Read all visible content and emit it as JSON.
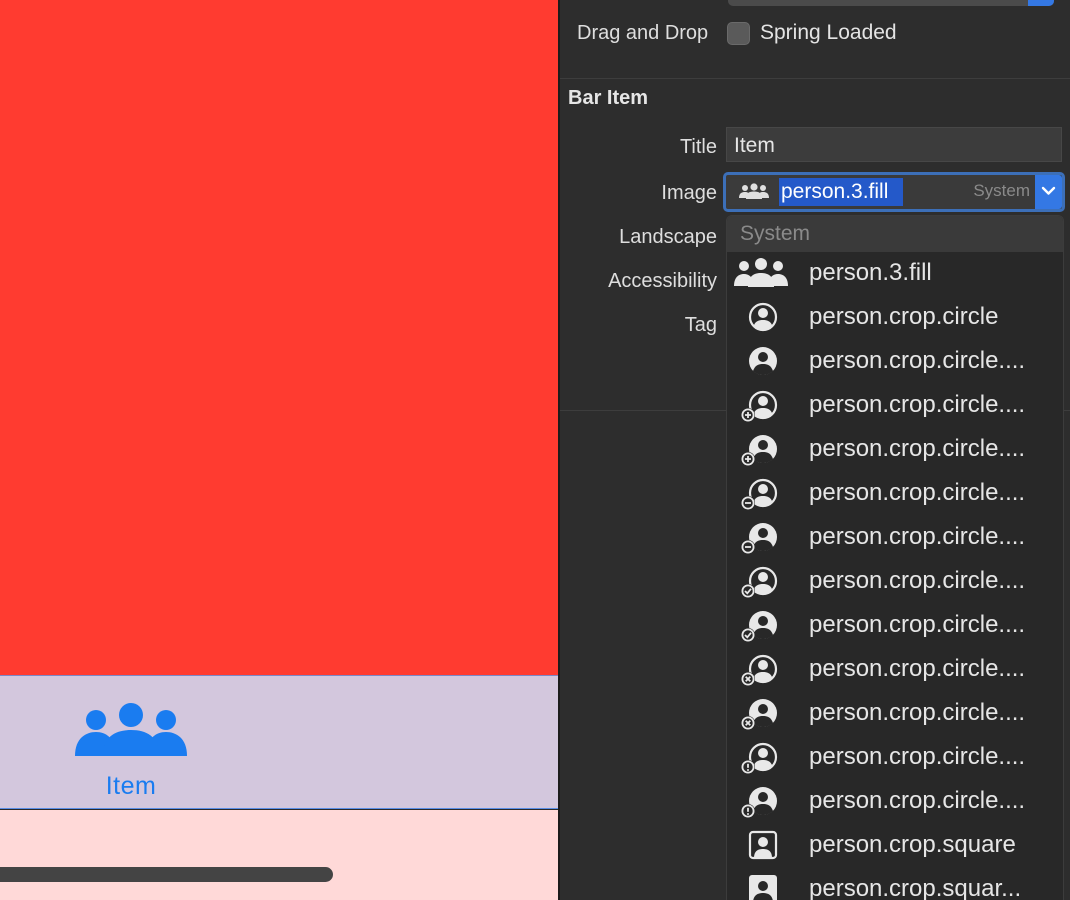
{
  "canvas": {
    "tab_item_label": "Item"
  },
  "inspector": {
    "drag_drop_label": "Drag and Drop",
    "spring_loaded_label": "Spring Loaded",
    "section_title": "Bar Item",
    "title_label": "Title",
    "title_value": "Item",
    "image_label": "Image",
    "image_value": "person.3.fill",
    "image_badge": "System",
    "landscape_label": "Landscape",
    "accessibility_label": "Accessibility",
    "tag_label": "Tag"
  },
  "popup": {
    "header": "System",
    "options": [
      {
        "label": "person.3.fill",
        "icon": "person-3-fill-icon"
      },
      {
        "label": "person.crop.circle",
        "icon": "person-crop-circle-icon"
      },
      {
        "label": "person.crop.circle....",
        "icon": "person-crop-circle-fill-icon"
      },
      {
        "label": "person.crop.circle....",
        "icon": "person-crop-circle-badge-plus-icon"
      },
      {
        "label": "person.crop.circle....",
        "icon": "person-crop-circle-fill-badge-plus-icon"
      },
      {
        "label": "person.crop.circle....",
        "icon": "person-crop-circle-badge-minus-icon"
      },
      {
        "label": "person.crop.circle....",
        "icon": "person-crop-circle-fill-badge-minus-icon"
      },
      {
        "label": "person.crop.circle....",
        "icon": "person-crop-circle-badge-checkmark-icon"
      },
      {
        "label": "person.crop.circle....",
        "icon": "person-crop-circle-fill-badge-checkmark-icon"
      },
      {
        "label": "person.crop.circle....",
        "icon": "person-crop-circle-badge-xmark-icon"
      },
      {
        "label": "person.crop.circle....",
        "icon": "person-crop-circle-fill-badge-xmark-icon"
      },
      {
        "label": "person.crop.circle....",
        "icon": "person-crop-circle-badge-exclamation-icon"
      },
      {
        "label": "person.crop.circle....",
        "icon": "person-crop-circle-fill-badge-exclamation-icon"
      },
      {
        "label": "person.crop.square",
        "icon": "person-crop-square-icon"
      },
      {
        "label": "person.crop.squar...",
        "icon": "person-crop-square-fill-icon"
      }
    ]
  },
  "colors": {
    "canvas_red": "#ff3b30",
    "tab_bar_bg": "#d3c7dd",
    "tint_blue": "#1a7cf0",
    "selection_blue": "#2459c9",
    "inspector_bg": "#2d2d2d"
  }
}
